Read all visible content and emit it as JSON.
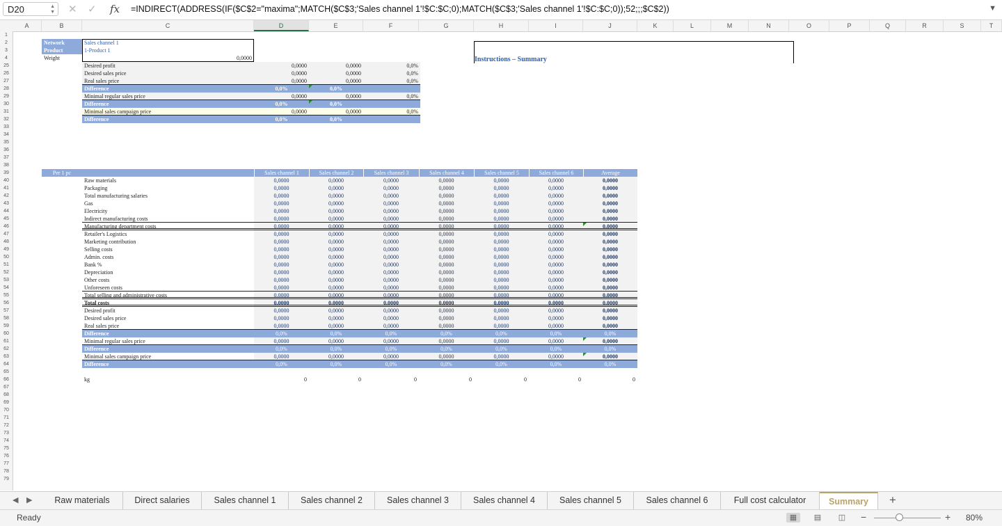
{
  "formula_bar": {
    "cell_ref": "D20",
    "cancel_icon": "✕",
    "confirm_icon": "✓",
    "fx_label": "fx",
    "formula": "=INDIRECT(ADDRESS(IF($C$2=\"maxima\";MATCH($C$3;'Sales channel 1'!$C:$C;0);MATCH($C$3;'Sales channel 1'!$C:$C;0));52;;;$C$2))"
  },
  "columns": [
    "A",
    "B",
    "C",
    "D",
    "E",
    "F",
    "G",
    "H",
    "I",
    "J",
    "K",
    "L",
    "M",
    "N",
    "O",
    "P",
    "Q",
    "R",
    "S",
    "T"
  ],
  "selected_column": "D",
  "rows": [
    "1",
    "2",
    "3",
    "4",
    "25",
    "26",
    "27",
    "28",
    "29",
    "30",
    "31",
    "32",
    "33",
    "34",
    "35",
    "36",
    "37",
    "38",
    "39",
    "40",
    "41",
    "42",
    "43",
    "44",
    "45",
    "46",
    "47",
    "48",
    "49",
    "50",
    "51",
    "52",
    "53",
    "54",
    "55",
    "56",
    "57",
    "58",
    "59",
    "60",
    "61",
    "62",
    "63",
    "64",
    "65",
    "66",
    "67",
    "68",
    "69",
    "70",
    "71",
    "72",
    "73",
    "74",
    "75",
    "76",
    "77",
    "78",
    "79"
  ],
  "header_block": {
    "network_label": "Network",
    "network_value": "Sales channel 1",
    "product_label": "Product",
    "product_value": "1-Product 1",
    "weight_label": "Weight",
    "weight_value": "0,0000"
  },
  "instructions_title": "Instructions – Summary",
  "top_table": [
    {
      "label": "Desired profit",
      "d": "0,0000",
      "e": "0,0000",
      "f": "0,0%",
      "style": "shade"
    },
    {
      "label": "Desired sales price",
      "d": "0,0000",
      "e": "0,0000",
      "f": "0,0%",
      "style": "shade"
    },
    {
      "label": "Real sales price",
      "d": "0,0000",
      "e": "0,0000",
      "f": "0,0%",
      "style": "shade ul"
    },
    {
      "label": "Difference",
      "d": "0,0%",
      "e": "0,0%",
      "f": "",
      "style": "blue"
    },
    {
      "label": "Minimal regular sales price",
      "d": "0,0000",
      "e": "0,0000",
      "f": "0,0%",
      "style": "shade ul"
    },
    {
      "label": "Difference",
      "d": "0,0%",
      "e": "0,0%",
      "f": "",
      "style": "blue"
    },
    {
      "label": "Minimal sales campaign price",
      "d": "0,0000",
      "e": "0,0000",
      "f": "0,0%",
      "style": "yellow ul"
    },
    {
      "label": "Difference",
      "d": "0,0%",
      "e": "0,0%",
      "f": "",
      "style": "blue"
    }
  ],
  "main_table": {
    "corner": "Per 1 pc",
    "headers": [
      "Sales channel 1",
      "Sales channel 2",
      "Sales channel 3",
      "Sales channel 4",
      "Sales channel 5",
      "Sales channel 6",
      "Average"
    ],
    "rows": [
      {
        "label": "Raw materials",
        "v": "0,0000",
        "style": ""
      },
      {
        "label": "Packaging",
        "v": "0,0000",
        "style": ""
      },
      {
        "label": "Total manufacturing salaries",
        "v": "0,0000",
        "style": ""
      },
      {
        "label": "Gas",
        "v": "0,0000",
        "style": ""
      },
      {
        "label": "Electricity",
        "v": "0,0000",
        "style": ""
      },
      {
        "label": "Indirect manufacturing costs",
        "v": "0,0000",
        "style": "ul"
      },
      {
        "label": "Manufacturing department costs",
        "v": "0,0000",
        "style": "dbl"
      },
      {
        "label": "Retailer's Logistics",
        "v": "0,0000",
        "style": ""
      },
      {
        "label": "Marketing contribution",
        "v": "0,0000",
        "style": ""
      },
      {
        "label": "Selling costs",
        "v": "0,0000",
        "style": ""
      },
      {
        "label": "Admin. costs",
        "v": "0,0000",
        "style": ""
      },
      {
        "label": "Bank %",
        "v": "0,0000",
        "style": ""
      },
      {
        "label": "Depreciation",
        "v": "0,0000",
        "style": ""
      },
      {
        "label": "Other costs",
        "v": "0,0000",
        "style": ""
      },
      {
        "label": "Unforeseen costs",
        "v": "0,0000",
        "style": "ul"
      },
      {
        "label": "Total selling and administrative costs",
        "v": "0,0000",
        "style": "dbl"
      },
      {
        "label": "Total costs",
        "v": "0,0000",
        "style": "dbl bold"
      },
      {
        "label": "Desired profit",
        "v": "0,0000",
        "style": ""
      },
      {
        "label": "Desired sales price",
        "v": "0,0000",
        "style": ""
      },
      {
        "label": "Real sales price",
        "v": "0,0000",
        "style": "ul"
      },
      {
        "label": "Difference",
        "v": "0,0%",
        "style": "blue"
      },
      {
        "label": "Minimal regular sales price",
        "v": "0,0000",
        "style": "ul"
      },
      {
        "label": "Difference",
        "v": "0,0%",
        "style": "blue"
      },
      {
        "label": "Minimal sales campaign price",
        "v": "0,0000",
        "style": "ul"
      },
      {
        "label": "Difference",
        "v": "0,0%",
        "style": "blue"
      }
    ]
  },
  "kg_row": {
    "label": "kg",
    "values": [
      "0",
      "0",
      "0",
      "0",
      "0",
      "0",
      "0"
    ]
  },
  "sheet_tabs": [
    "Raw materials",
    "Direct salaries",
    "Sales channel 1",
    "Sales channel 2",
    "Sales channel 3",
    "Sales channel 4",
    "Sales channel 5",
    "Sales channel 6",
    "Full cost calculator",
    "Summary"
  ],
  "active_tab": "Summary",
  "add_sheet": "+",
  "status": {
    "ready": "Ready",
    "zoom": "80%",
    "zoom_minus": "−",
    "zoom_plus": "+"
  },
  "colors": {
    "header_blue": "#8eaadb",
    "accent_green": "#217346",
    "active_tab": "#b7a46a",
    "navy_text": "#1f3864"
  }
}
